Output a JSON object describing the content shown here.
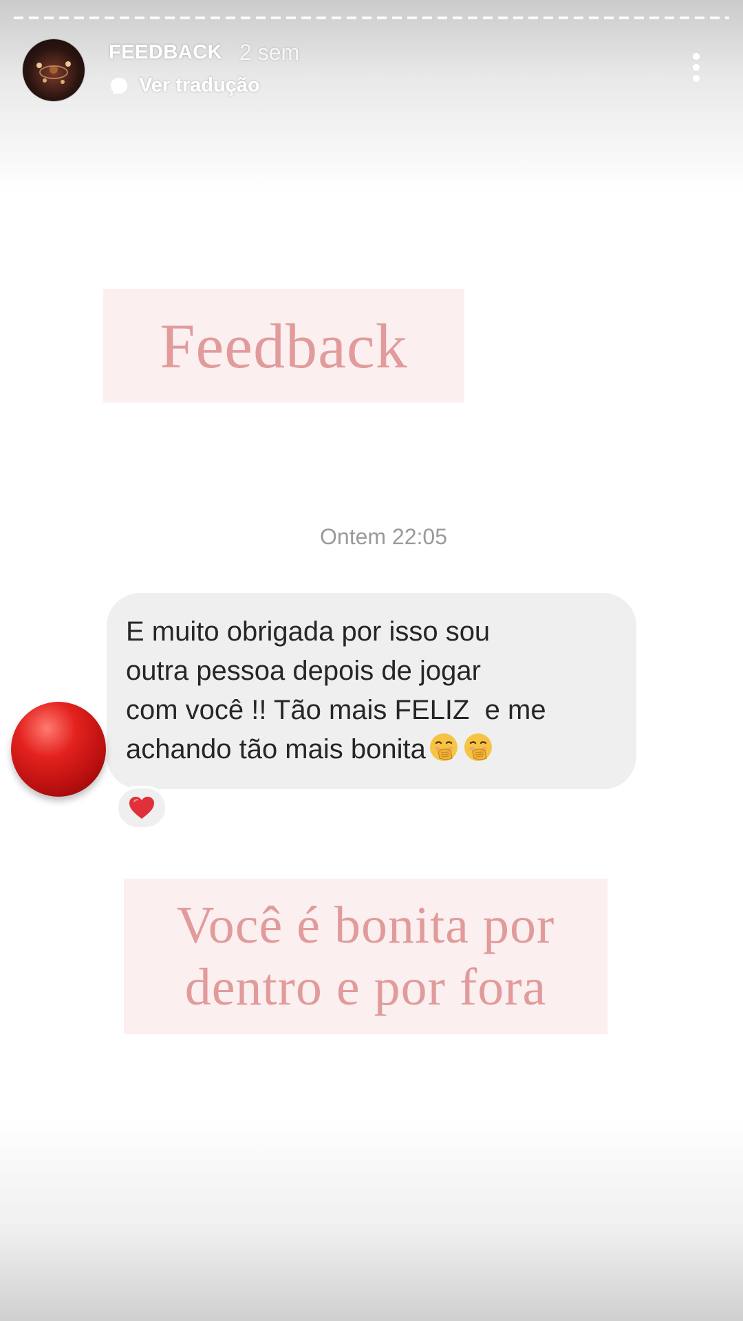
{
  "header": {
    "username": "FEEDBACK",
    "time_ago": "2 sem",
    "translate_label": "Ver tradução"
  },
  "story": {
    "title": "Feedback",
    "timestamp": "Ontem 22:05",
    "message": {
      "text": "E muito obrigada por isso sou\noutra pessoa depois de jogar\ncom você !! Tão mais FELIZ  e me\nachando tão mais bonita",
      "emojis": [
        "face-with-hand-over-mouth-emoji",
        "face-with-hand-over-mouth-emoji"
      ],
      "reaction": "heart-reaction"
    },
    "quote_line1": "Você é bonita por",
    "quote_line2": "dentro e por fora"
  },
  "colors": {
    "accent_pink_text": "#e19b9b",
    "accent_pink_bg": "#fbeff0",
    "bubble_bg": "#efefef",
    "heart_red": "#e0303a",
    "avatar_red": "#e3221f"
  }
}
